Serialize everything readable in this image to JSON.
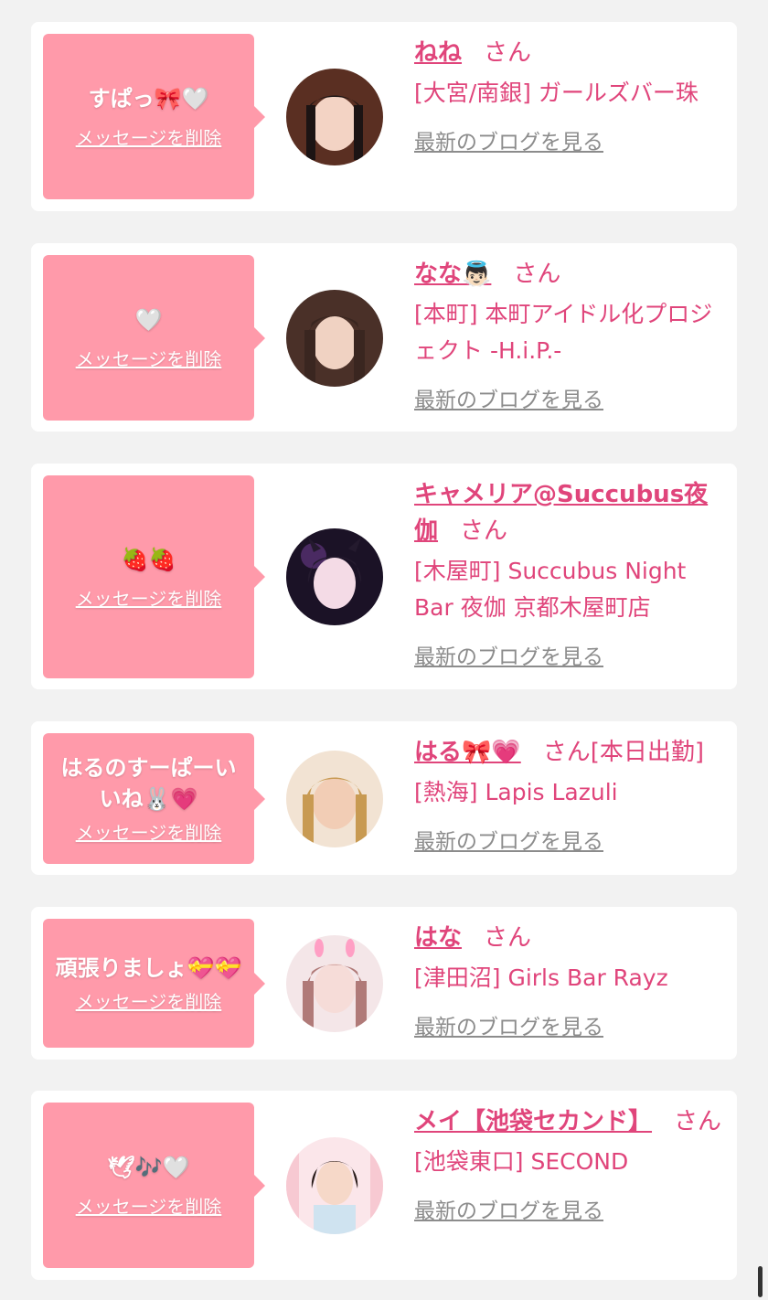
{
  "theme": {
    "accent": "#e0457b",
    "bubble": "#ff9aaa",
    "link_gray": "#8c8c8c",
    "background": "#f2f2f2"
  },
  "cards": [
    {
      "message": "すぱっ🎀🤍",
      "delete_label": "メッセージを削除",
      "name": "ねね",
      "san": "さん",
      "extra": "",
      "shop": "[大宮/南銀] ガールズバー珠",
      "blog_label": "最新のブログを見る",
      "avatar_icon": "avatar-photo"
    },
    {
      "message": "🤍",
      "delete_label": "メッセージを削除",
      "name": "なな👼🏻",
      "san": "さん",
      "extra": "",
      "shop": "[本町] 本町アイドル化プロジェクト -H.i.P.-",
      "blog_label": "最新のブログを見る",
      "avatar_icon": "avatar-photo"
    },
    {
      "message": "🍓🍓",
      "delete_label": "メッセージを削除",
      "name": "キャメリア@Succubus夜伽",
      "san": "さん",
      "extra": "",
      "shop": "[木屋町] Succubus Night Bar 夜伽 京都木屋町店",
      "blog_label": "最新のブログを見る",
      "avatar_icon": "avatar-photo"
    },
    {
      "message": "はるのすーぱーいいね🐰💗",
      "delete_label": "メッセージを削除",
      "name": "はる🎀💗",
      "san": "さん",
      "extra": "[本日出勤]",
      "shop": "[熱海] Lapis Lazuli",
      "blog_label": "最新のブログを見る",
      "avatar_icon": "avatar-photo"
    },
    {
      "message": "頑張りましょ💝💝",
      "delete_label": "メッセージを削除",
      "name": "はな",
      "san": "さん",
      "extra": "",
      "shop": "[津田沼] Girls Bar Rayz",
      "blog_label": "最新のブログを見る",
      "avatar_icon": "avatar-photo"
    },
    {
      "message": "🕊🎶🤍",
      "delete_label": "メッセージを削除",
      "name": "メイ【池袋セカンド】",
      "san": "さん",
      "extra": "",
      "shop": "[池袋東口] SECOND",
      "blog_label": "最新のブログを見る",
      "avatar_icon": "avatar-photo"
    }
  ]
}
